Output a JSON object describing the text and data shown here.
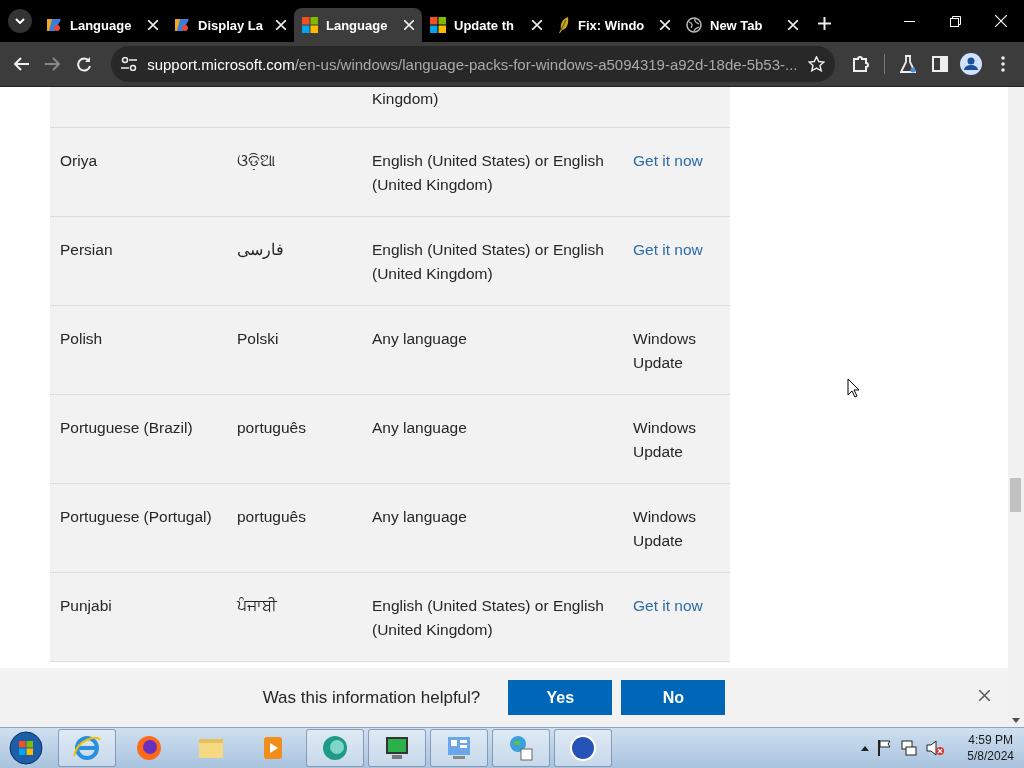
{
  "browser": {
    "tabs": [
      {
        "title": "Language",
        "kind": "zlogo",
        "selected": false
      },
      {
        "title": "Display La",
        "kind": "zlogo",
        "selected": false
      },
      {
        "title": "Language",
        "kind": "windows",
        "selected": true
      },
      {
        "title": "Update th",
        "kind": "windows",
        "selected": false
      },
      {
        "title": "Fix: Windo",
        "kind": "feather",
        "selected": false
      },
      {
        "title": "New Tab",
        "kind": "globe",
        "selected": false
      }
    ],
    "address": {
      "domain": "support.microsoft.com",
      "path": "/en-us/windows/language-packs-for-windows-a5094319-a92d-18de-5b53-..."
    }
  },
  "table": {
    "partial_row": {
      "column_3": "Kingdom)"
    },
    "rows": [
      {
        "column_1": "Oriya",
        "column_2": "ଓଡ଼ିଆ",
        "column_3": "English (United States) or English (United Kingdom)",
        "column_4": "Get it now",
        "kind": "link"
      },
      {
        "column_1": "Persian",
        "column_2": "فارسی",
        "column_3": "English (United States) or English (United Kingdom)",
        "column_4": "Get it now",
        "kind": "link"
      },
      {
        "column_1": "Polish",
        "column_2": "Polski",
        "column_3": "Any language",
        "column_4": "Windows Update",
        "kind": "text"
      },
      {
        "column_1": "Portuguese (Brazil)",
        "column_2": "português",
        "column_3": "Any language",
        "column_4": "Windows Update",
        "kind": "text"
      },
      {
        "column_1": "Portuguese (Portugal)",
        "column_2": "português",
        "column_3": "Any language",
        "column_4": "Windows Update",
        "kind": "text"
      },
      {
        "column_1": "Punjabi",
        "column_2": "ਪੰਜਾਬੀ",
        "column_3": "English (United States) or English (United Kingdom)",
        "column_4": "Get it now",
        "kind": "link"
      }
    ]
  },
  "feedback": {
    "question": "Was this information helpful?",
    "buttons": [
      "Yes",
      "No"
    ]
  },
  "taskbar": {
    "time": "4:59 PM",
    "date": "5/8/2024"
  }
}
